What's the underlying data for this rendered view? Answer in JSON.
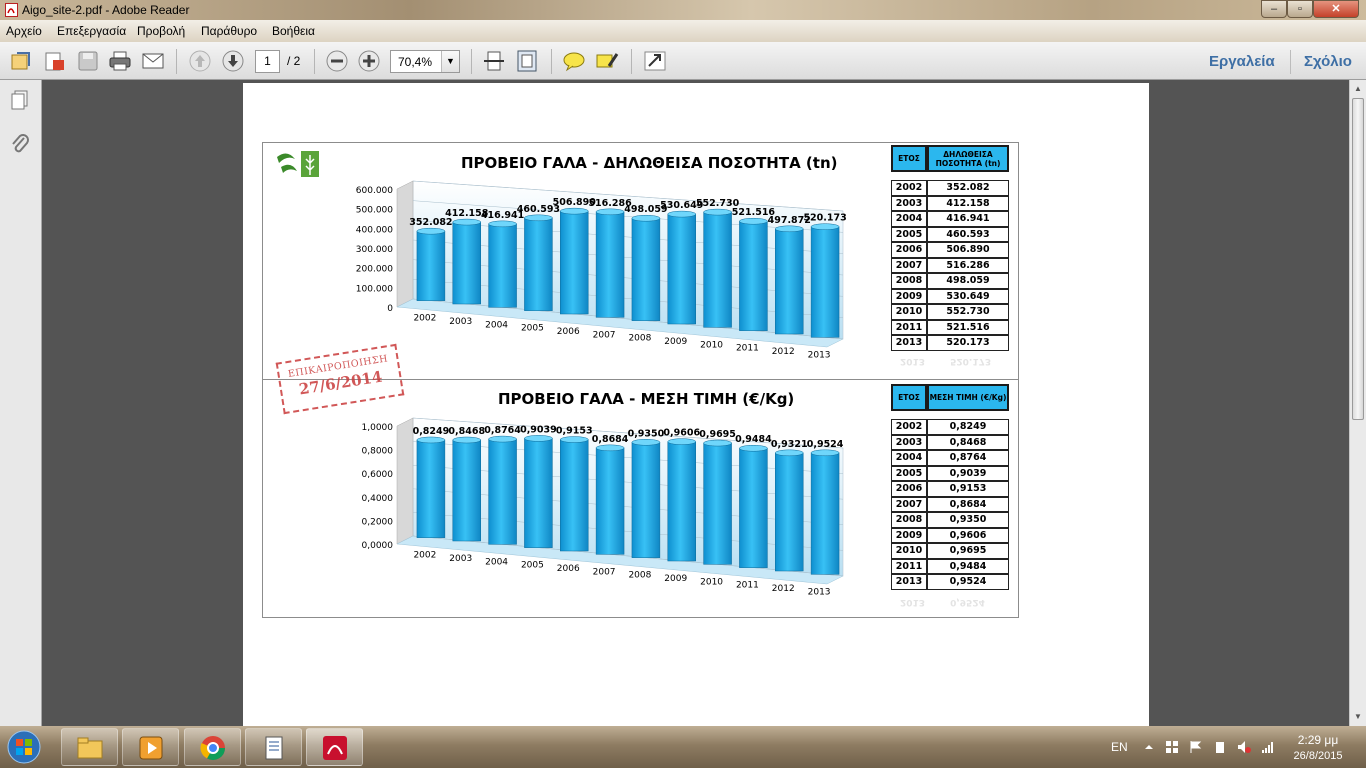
{
  "window": {
    "title": "Aigo_site-2.pdf - Adobe Reader"
  },
  "menu": [
    "Αρχείο",
    "Επεξεργασία",
    "Προβολή",
    "Παράθυρο",
    "Βοήθεια"
  ],
  "toolbar": {
    "page_current": "1",
    "page_total": "/ 2",
    "zoom": "70,4%",
    "tools_label": "Εργαλεία",
    "comment_label": "Σχόλιο"
  },
  "document": {
    "stamp": {
      "line1": "ΕΠΙΚΑΙΡΟΠΟΙΗΣΗ",
      "line2": "27/6/2014"
    },
    "chart1_table": {
      "header_year": "ΕΤΟΣ",
      "header_value": "ΔΗΛΩΘΕΙΣΑ ΠΟΣΟΤΗΤΑ (tn)",
      "rows": [
        {
          "year": "2002",
          "value": "352.082"
        },
        {
          "year": "2003",
          "value": "412.158"
        },
        {
          "year": "2004",
          "value": "416.941"
        },
        {
          "year": "2005",
          "value": "460.593"
        },
        {
          "year": "2006",
          "value": "506.890"
        },
        {
          "year": "2007",
          "value": "516.286"
        },
        {
          "year": "2008",
          "value": "498.059"
        },
        {
          "year": "2009",
          "value": "530.649"
        },
        {
          "year": "2010",
          "value": "552.730"
        },
        {
          "year": "2011",
          "value": "521.516"
        },
        {
          "year": "2013",
          "value": "520.173"
        }
      ]
    },
    "chart2_table": {
      "header_year": "ΕΤΟΣ",
      "header_value": "ΜΕΣΗ ΤΙΜΗ (€/Kg)",
      "rows": [
        {
          "year": "2002",
          "value": "0,8249"
        },
        {
          "year": "2003",
          "value": "0,8468"
        },
        {
          "year": "2004",
          "value": "0,8764"
        },
        {
          "year": "2005",
          "value": "0,9039"
        },
        {
          "year": "2006",
          "value": "0,9153"
        },
        {
          "year": "2007",
          "value": "0,8684"
        },
        {
          "year": "2008",
          "value": "0,9350"
        },
        {
          "year": "2009",
          "value": "0,9606"
        },
        {
          "year": "2010",
          "value": "0,9695"
        },
        {
          "year": "2011",
          "value": "0,9484"
        },
        {
          "year": "2013",
          "value": "0,9524"
        }
      ]
    }
  },
  "chart_data": [
    {
      "type": "bar",
      "title": "ΠΡΟΒΕΙΟ ΓΑΛΑ - ΔΗΛΩΘΕΙΣΑ ΠΟΣΟΤΗΤΑ (tn)",
      "categories": [
        "2002",
        "2003",
        "2004",
        "2005",
        "2006",
        "2007",
        "2008",
        "2009",
        "2010",
        "2011",
        "2012",
        "2013"
      ],
      "values": [
        352082,
        412158,
        416941,
        460593,
        506890,
        516286,
        498059,
        530649,
        552730,
        521516,
        497872,
        520173
      ],
      "value_labels": [
        "352.082",
        "412.158",
        "416.941",
        "460.593",
        "506.890",
        "516.286",
        "498.059",
        "530.649",
        "552.730",
        "521.516",
        "497.872",
        "520.173"
      ],
      "yticks": [
        "0",
        "100.000",
        "200.000",
        "300.000",
        "400.000",
        "500.000",
        "600.000"
      ],
      "ylim": [
        0,
        600000
      ],
      "color": "#1fa9e6"
    },
    {
      "type": "bar",
      "title": "ΠΡΟΒΕΙΟ ΓΑΛΑ - ΜΕΣΗ ΤΙΜΗ (€/Kg)",
      "categories": [
        "2002",
        "2003",
        "2004",
        "2005",
        "2006",
        "2007",
        "2008",
        "2009",
        "2010",
        "2011",
        "2012",
        "2013"
      ],
      "values": [
        0.8249,
        0.8468,
        0.8764,
        0.9039,
        0.9153,
        0.8684,
        0.935,
        0.9606,
        0.9695,
        0.9484,
        0.9321,
        0.9524
      ],
      "value_labels": [
        "0,8249",
        "0,8468",
        "0,8764",
        "0,9039",
        "0,9153",
        "0,8684",
        "0,9350",
        "0,9606",
        "0,9695",
        "0,9484",
        "0,9321",
        "0,9524"
      ],
      "yticks": [
        "0,0000",
        "0,2000",
        "0,4000",
        "0,6000",
        "0,8000",
        "1,0000"
      ],
      "ylim": [
        0,
        1
      ],
      "color": "#1fa9e6"
    }
  ],
  "taskbar": {
    "lang": "EN",
    "time": "2:29 μμ",
    "date": "26/8/2015"
  }
}
